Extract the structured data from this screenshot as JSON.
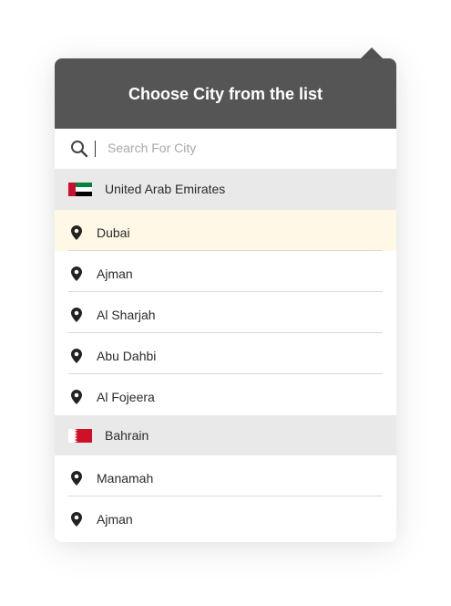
{
  "header": {
    "title": "Choose City from the list"
  },
  "search": {
    "placeholder": "Search For City",
    "value": ""
  },
  "colors": {
    "header_bg": "#555555",
    "selected_bg": "#fff8e6",
    "country_bg": "#e9e9e9"
  },
  "groups": [
    {
      "country": "United Arab Emirates",
      "flag_icon": "uae-flag-icon",
      "cities": [
        "Dubai",
        "Ajman",
        "Al Sharjah",
        "Abu Dahbi",
        "Al Fojeera"
      ],
      "selected_city": "Dubai"
    },
    {
      "country": "Bahrain",
      "flag_icon": "bahrain-flag-icon",
      "cities": [
        "Manamah",
        "Ajman"
      ]
    }
  ]
}
